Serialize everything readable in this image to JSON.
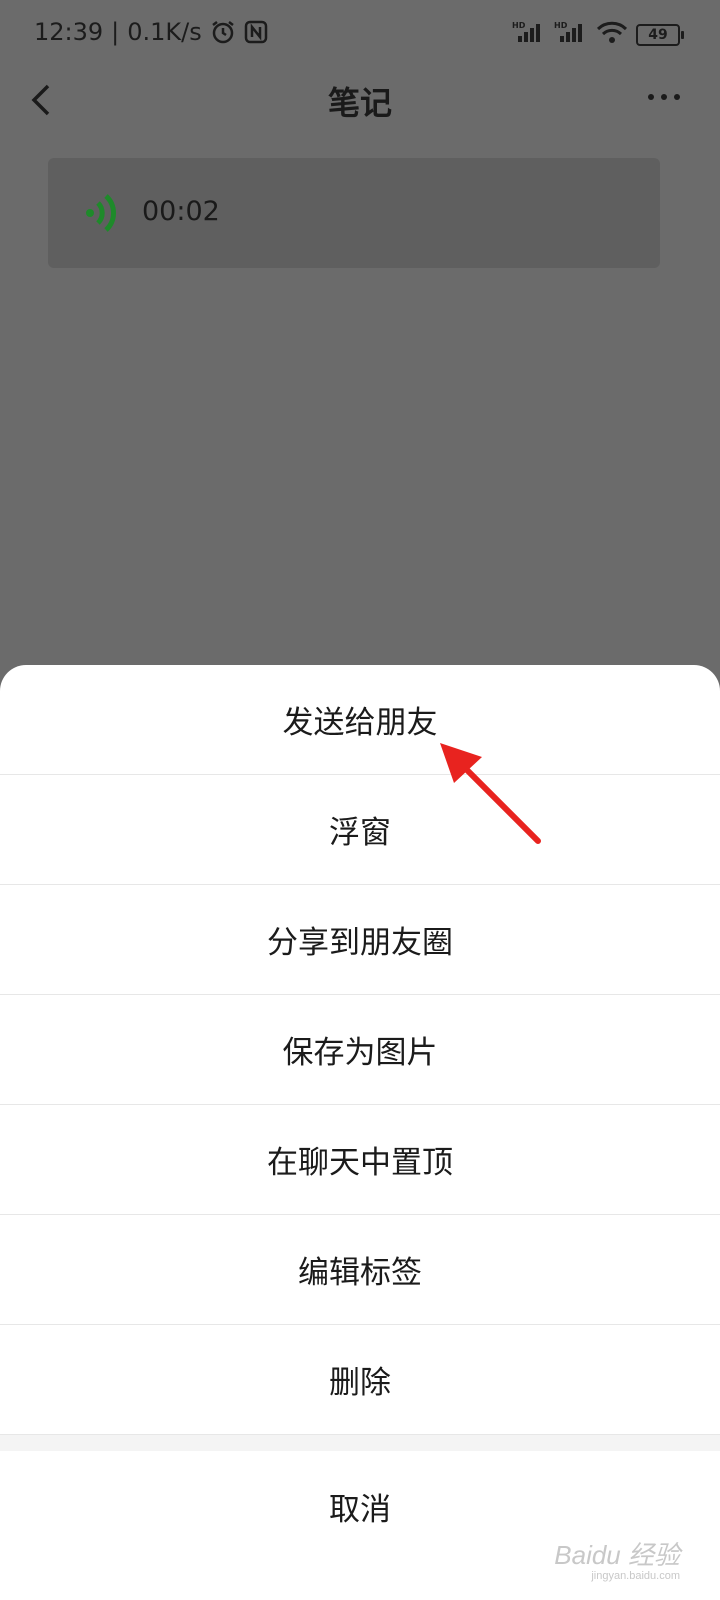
{
  "status": {
    "time": "12:39",
    "speed": "0.1K/s",
    "battery": "49"
  },
  "nav": {
    "title": "笔记"
  },
  "voice": {
    "duration": "00:02",
    "icon_color": "#1e8a2a"
  },
  "sheet": {
    "items": [
      {
        "label": "发送给朋友"
      },
      {
        "label": "浮窗"
      },
      {
        "label": "分享到朋友圈"
      },
      {
        "label": "保存为图片"
      },
      {
        "label": "在聊天中置顶"
      },
      {
        "label": "编辑标签"
      },
      {
        "label": "删除"
      }
    ],
    "cancel": "取消"
  },
  "watermark": {
    "text": "Baidu 经验",
    "sub": "jingyan.baidu.com"
  },
  "colors": {
    "overlay": "#6b6b6b",
    "annotation_arrow": "#e8231f"
  }
}
